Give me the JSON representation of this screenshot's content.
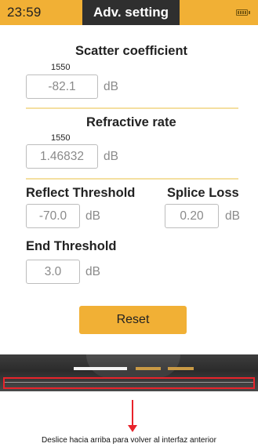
{
  "status_bar": {
    "time": "23:59",
    "title": "Adv. setting",
    "battery_icon": "battery-icon"
  },
  "scatter": {
    "heading": "Scatter coefficient",
    "wavelength": "1550",
    "value": "-82.1",
    "unit": "dB"
  },
  "refractive": {
    "heading": "Refractive rate",
    "wavelength": "1550",
    "value": "1.46832",
    "unit": "dB"
  },
  "reflect_threshold": {
    "heading": "Reflect Threshold",
    "value": "-70.0",
    "unit": "dB"
  },
  "splice_loss": {
    "heading": "Splice Loss",
    "value": "0.20",
    "unit": "dB"
  },
  "end_threshold": {
    "heading": "End Threshold",
    "value": "3.0",
    "unit": "dB"
  },
  "reset_label": "Reset",
  "hint": "Deslice hacia arriba para volver al interfaz anterior",
  "colors": {
    "accent": "#f1b035",
    "title_bg": "#2f2f2f",
    "annotation": "#e8232b"
  }
}
